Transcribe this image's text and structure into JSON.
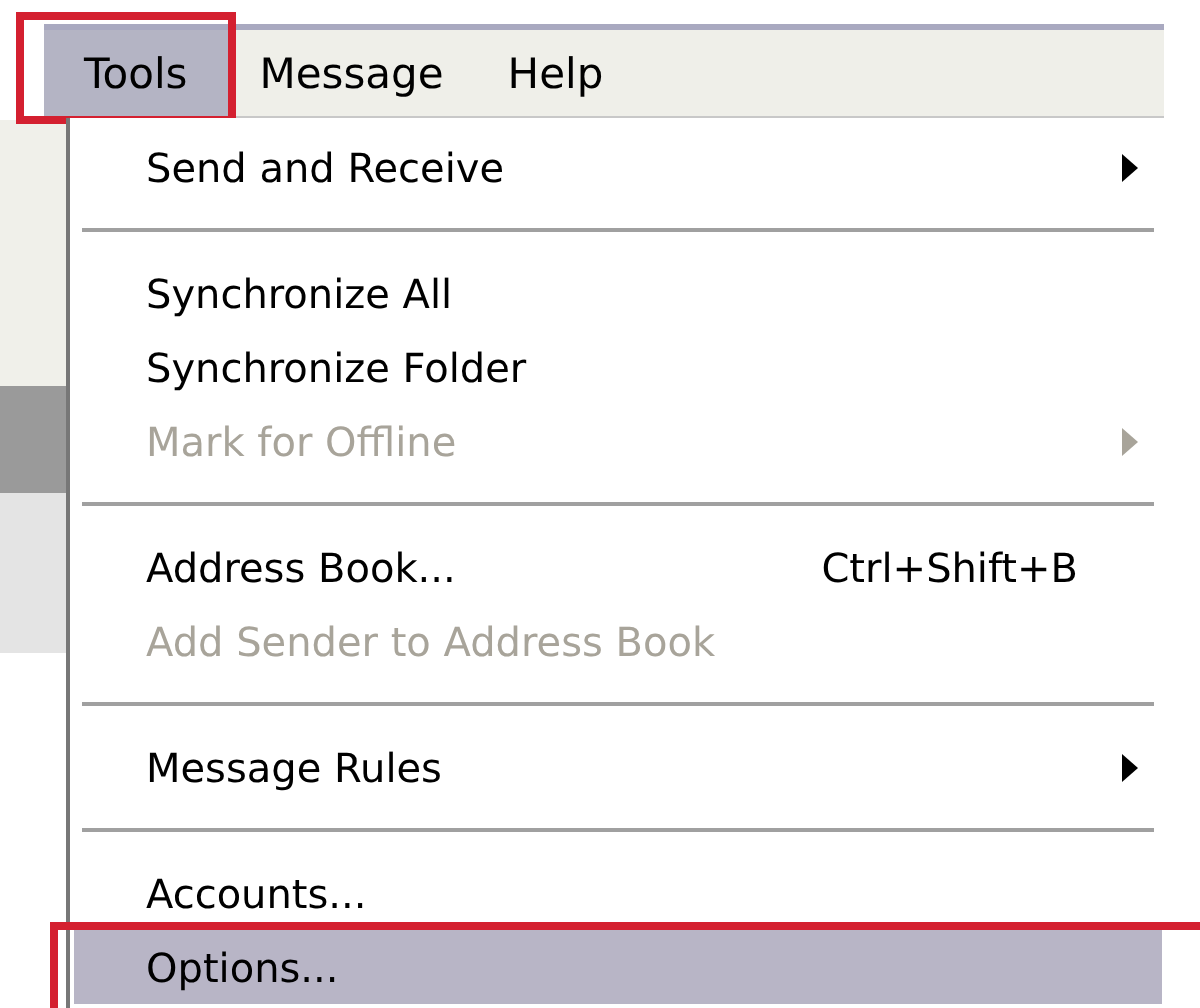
{
  "menubar": [
    {
      "label": "Tools",
      "selected": true,
      "annotated": true
    },
    {
      "label": "Message",
      "selected": false,
      "annotated": false
    },
    {
      "label": "Help",
      "selected": false,
      "annotated": false
    }
  ],
  "menu": [
    {
      "kind": "item",
      "label": "Send and Receive",
      "submenu": true,
      "disabled": false,
      "selected": false,
      "annotated": false
    },
    {
      "kind": "separator"
    },
    {
      "kind": "item",
      "label": "Synchronize All",
      "submenu": false,
      "disabled": false,
      "selected": false,
      "annotated": false
    },
    {
      "kind": "item",
      "label": "Synchronize Folder",
      "submenu": false,
      "disabled": false,
      "selected": false,
      "annotated": false
    },
    {
      "kind": "item",
      "label": "Mark for Offline",
      "submenu": true,
      "disabled": true,
      "selected": false,
      "annotated": false
    },
    {
      "kind": "separator"
    },
    {
      "kind": "item",
      "label": "Address Book...",
      "shortcut": "Ctrl+Shift+B",
      "submenu": false,
      "disabled": false,
      "selected": false,
      "annotated": false
    },
    {
      "kind": "item",
      "label": "Add Sender to Address Book",
      "submenu": false,
      "disabled": true,
      "selected": false,
      "annotated": false
    },
    {
      "kind": "separator"
    },
    {
      "kind": "item",
      "label": "Message Rules",
      "submenu": true,
      "disabled": false,
      "selected": false,
      "annotated": false
    },
    {
      "kind": "separator"
    },
    {
      "kind": "item",
      "label": "Accounts...",
      "submenu": false,
      "disabled": false,
      "selected": false,
      "annotated": false
    },
    {
      "kind": "item",
      "label": "Options...",
      "submenu": false,
      "disabled": false,
      "selected": true,
      "annotated": true
    }
  ]
}
